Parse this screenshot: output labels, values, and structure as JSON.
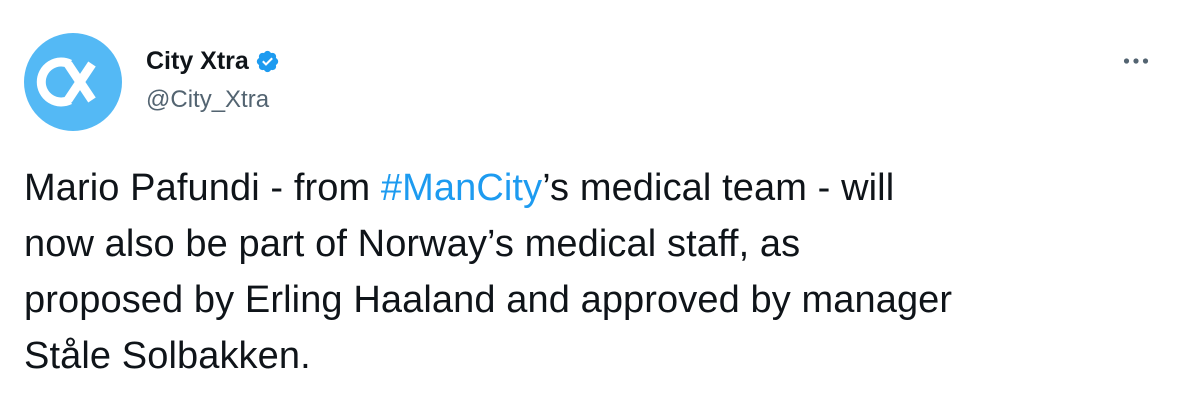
{
  "author": {
    "display_name": "City Xtra",
    "handle": "@City_Xtra",
    "avatar_text": "CX",
    "verified": true
  },
  "colors": {
    "avatar_bg": "#54b9f5",
    "verified_badge": "#1d9bf0",
    "hashtag": "#1d9bf0",
    "handle_text": "#536471",
    "body_text": "#0f1419"
  },
  "icons": {
    "verified": "verified-badge-icon",
    "more": "more-horizontal-icon"
  },
  "tweet": {
    "line1_before": "Mario Pafundi - from ",
    "hashtag": "#ManCity",
    "line1_after": "’s medical team - will",
    "line2": "now also be part of Norway’s medical staff, as",
    "line3": "proposed by Erling Haaland and approved by manager",
    "line4": "Ståle Solbakken."
  }
}
